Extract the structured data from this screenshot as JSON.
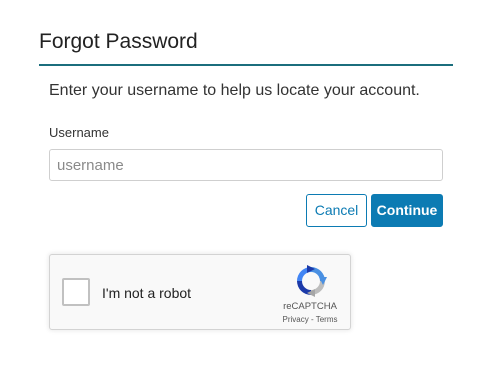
{
  "page": {
    "title": "Forgot Password",
    "instructions": "Enter your username to help us locate your account."
  },
  "form": {
    "username_label": "Username",
    "username_placeholder": "username",
    "username_value": "",
    "cancel_label": "Cancel",
    "continue_label": "Continue"
  },
  "recaptcha": {
    "label": "I'm not a robot",
    "brand": "reCAPTCHA",
    "privacy_label": "Privacy",
    "separator": " - ",
    "terms_label": "Terms",
    "checked": false,
    "icon": "recaptcha-logo-icon"
  },
  "colors": {
    "accent": "#0c7bb3",
    "title_rule": "#1b6e7d"
  }
}
